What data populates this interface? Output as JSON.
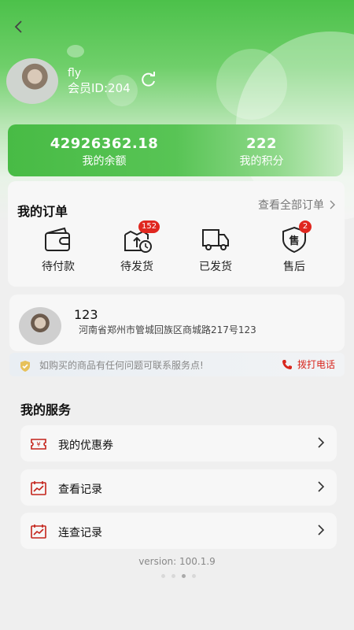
{
  "profile": {
    "name": "fly",
    "member_id": "会员ID:204"
  },
  "balance": {
    "amount": "42926362.18",
    "amount_label": "我的余额",
    "points": "222",
    "points_label": "我的积分"
  },
  "orders": {
    "title": "我的订单",
    "view_all": "查看全部订单",
    "items": [
      {
        "label": "待付款",
        "icon": "wallet-icon",
        "badge": ""
      },
      {
        "label": "待发货",
        "icon": "package-clock-icon",
        "badge": "152"
      },
      {
        "label": "已发货",
        "icon": "truck-icon",
        "badge": ""
      },
      {
        "label": "售后",
        "icon": "after-sales-shield-icon",
        "badge": "2",
        "icon_text": "售"
      }
    ]
  },
  "address": {
    "name": "123",
    "detail": "河南省郑州市管城回族区商城路217号123"
  },
  "notice": {
    "text": "如购买的商品有任何问题可联系服务点!",
    "call_label": "拨打电话"
  },
  "services": {
    "title": "我的服务",
    "items": [
      {
        "label": "我的优惠券",
        "icon": "coupon-icon"
      },
      {
        "label": "查看记录",
        "icon": "chart-record-icon"
      },
      {
        "label": "连查记录",
        "icon": "chart-record-icon"
      }
    ]
  },
  "footer": {
    "version": "version: 100.1.9"
  },
  "colors": {
    "brand_green": "#4cc14a",
    "accent_red": "#e0271f"
  }
}
